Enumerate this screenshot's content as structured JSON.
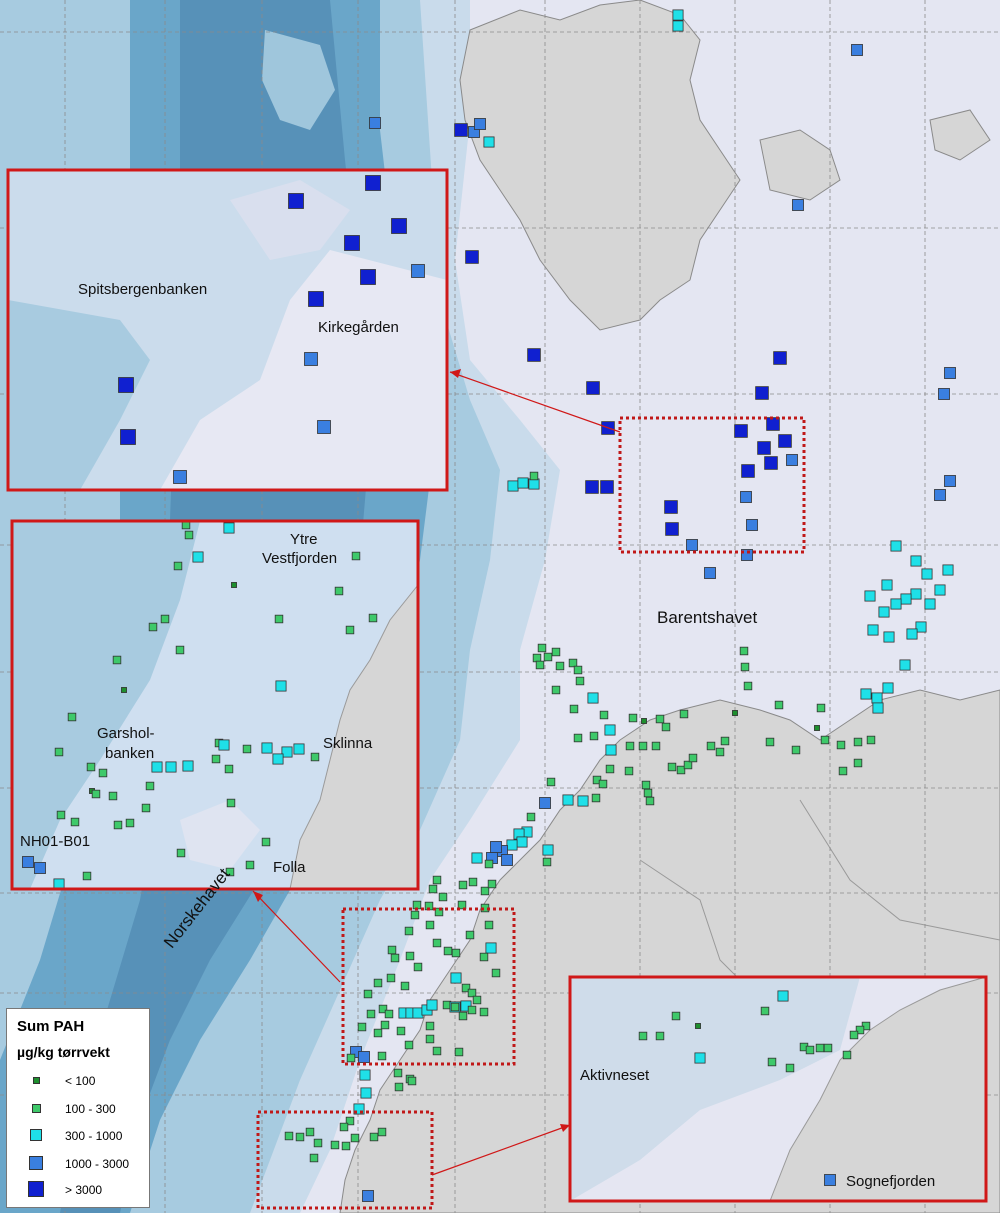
{
  "map": {
    "labels": {
      "barentshavet": "Barentshavet",
      "norskehavet": "Norskehavet"
    },
    "legend": {
      "title": "Sum PAH",
      "unit": "µg/kg tørrvekt",
      "classes": [
        {
          "range": "< 100",
          "color": "#1e8f2e"
        },
        {
          "range": "100 - 300",
          "color": "#3ec96a"
        },
        {
          "range": "300 - 1000",
          "color": "#1fe0e8"
        },
        {
          "range": "1000 - 3000",
          "color": "#3a7fe0"
        },
        {
          "range": "> 3000",
          "color": "#1020d0"
        }
      ]
    },
    "insets": {
      "spitsbergen": {
        "label_bank": "Spitsbergenbanken",
        "label_grave": "Kirkegården"
      },
      "mid_norway": {
        "label_ytre_1": "Ytre",
        "label_ytre_2": "Vestfjorden",
        "label_garshol_1": "Garshol-",
        "label_garshol_2": "banken",
        "label_sklinna": "Sklinna",
        "label_station": "NH01-B01",
        "label_folla": "Folla"
      },
      "west_norway": {
        "label_aktiv": "Aktivneset",
        "label_sogne": "Sognefjorden"
      }
    },
    "colors": {
      "ocean_deep": "#5f9fc4",
      "ocean_mid": "#9fc6dc",
      "ocean_shelf": "#c6d8ea",
      "sea_light": "#e2e4f1",
      "land": "#d6d6d6",
      "inset_frame": "#d01818"
    }
  }
}
